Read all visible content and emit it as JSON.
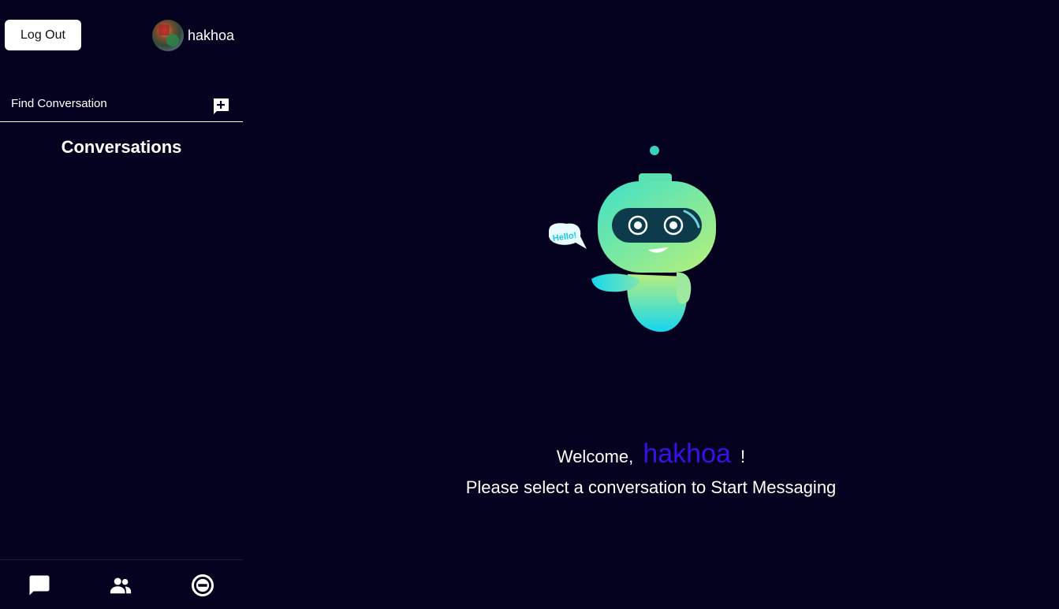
{
  "header": {
    "logout_label": "Log Out",
    "username": "hakhoa"
  },
  "search": {
    "placeholder": "Find Conversation"
  },
  "sidebar": {
    "conversations_title": "Conversations",
    "nav": [
      {
        "icon": "chat-icon"
      },
      {
        "icon": "people-icon"
      },
      {
        "icon": "block-icon"
      }
    ]
  },
  "main": {
    "welcome_prefix": "Welcome,",
    "welcome_name": "hakhoa",
    "welcome_suffix": "!",
    "select_prompt": "Please select a conversation to Start Messaging",
    "robot_bubble_text": "Hello!"
  },
  "colors": {
    "background": "#05021f",
    "accent_name": "#3b10e8"
  }
}
